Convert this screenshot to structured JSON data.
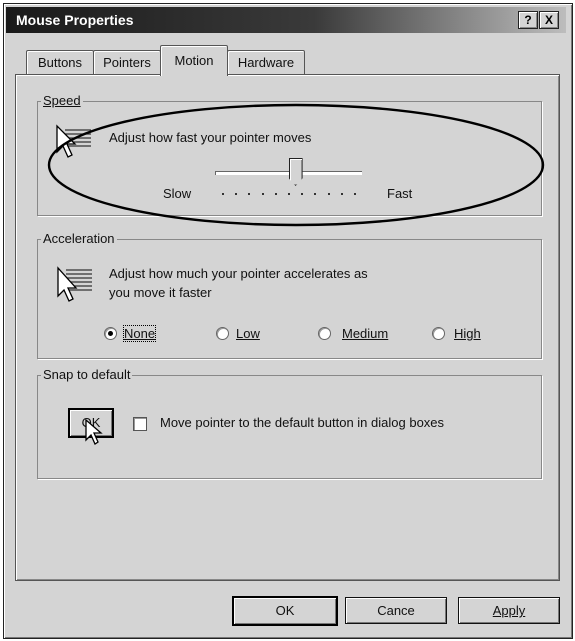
{
  "window": {
    "title": "Mouse Properties",
    "help_btn": "?",
    "close_btn": "X"
  },
  "tabs": [
    {
      "label": "Buttons"
    },
    {
      "label": "Pointers"
    },
    {
      "label": "Motion"
    },
    {
      "label": "Hardware"
    }
  ],
  "active_tab": "Motion",
  "speed": {
    "group_label": "Speed",
    "description": "Adjust how fast your pointer moves",
    "slow_label": "Slow",
    "fast_label": "Fast",
    "slider_value": 0.55,
    "tick_count": 11
  },
  "acceleration": {
    "group_label": "Acceleration",
    "description_line1": "Adjust how much your pointer accelerates as",
    "description_line2": "you move it faster",
    "options": [
      {
        "label": "None",
        "selected": true
      },
      {
        "label": "Low",
        "selected": false
      },
      {
        "label": "Medium",
        "selected": false
      },
      {
        "label": "High",
        "selected": false
      }
    ]
  },
  "snap": {
    "group_label": "Snap to default",
    "demo_button": "OK",
    "checkbox_label": "Move pointer to the default button in dialog boxes",
    "checked": false
  },
  "footer": {
    "ok": "OK",
    "cancel": "Cance",
    "apply": "Apply"
  }
}
